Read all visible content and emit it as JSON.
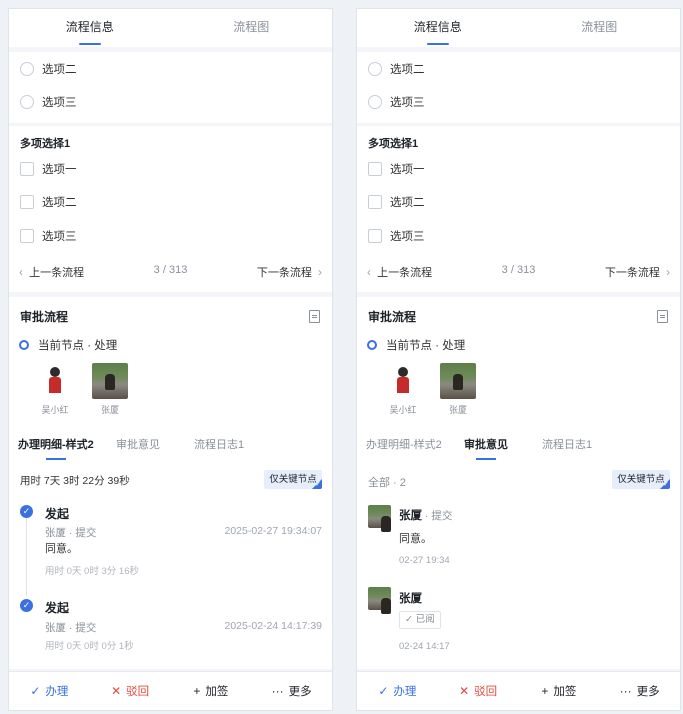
{
  "tabs": {
    "info": "流程信息",
    "chart": "流程图"
  },
  "radio_group": {
    "options": [
      "选项二",
      "选项三"
    ]
  },
  "multi_select": {
    "title": "多项选择1",
    "options": [
      "选项一",
      "选项二",
      "选项三"
    ]
  },
  "pager": {
    "prev": "上一条流程",
    "position": "3 / 313",
    "next": "下一条流程",
    "prev_icon": "‹",
    "next_icon": "›"
  },
  "approval": {
    "title": "审批流程",
    "current_node": "当前节点 · 处理",
    "handlers": [
      {
        "name": "吴小红"
      },
      {
        "name": "张厦"
      }
    ]
  },
  "subtabs": [
    "办理明细-样式2",
    "审批意见",
    "流程日志1"
  ],
  "left_panel": {
    "duration": "用时 7天 3时 22分 39秒",
    "key_button": "仅关键节点",
    "timeline": [
      {
        "title": "发起",
        "sub": "张厦 · 提交",
        "time": "2025-02-27 19:34:07",
        "text": "同意。",
        "duration": "用时 0天 0时 3分 16秒"
      },
      {
        "title": "发起",
        "sub": "张厦 · 提交",
        "time": "2025-02-24 14:17:39",
        "text": "",
        "duration": "用时 0天 0时 0分 1秒"
      }
    ]
  },
  "right_panel": {
    "summary": "全部 · 2",
    "key_button": "仅关键节点",
    "comments": [
      {
        "name": "张厦",
        "action": " · 提交",
        "text": "同意。",
        "badge": "",
        "date": "02-27 19:34"
      },
      {
        "name": "张厦",
        "action": "",
        "text": "",
        "badge": "✓ 已阅",
        "date": "02-24 14:17"
      }
    ]
  },
  "actions": [
    {
      "label": "办理",
      "icon": "✓",
      "color": "#3a70e2"
    },
    {
      "label": "驳回",
      "icon": "✕",
      "color": "#e5483f"
    },
    {
      "label": "加签",
      "icon": "+",
      "color": "#1f2329"
    },
    {
      "label": "更多",
      "icon": "···",
      "color": "#1f2329"
    }
  ],
  "colors": {
    "accent": "#3a70e2",
    "danger": "#e5483f"
  }
}
